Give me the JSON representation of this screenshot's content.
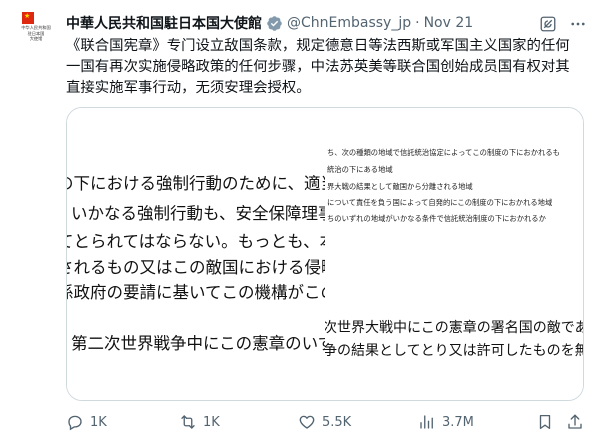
{
  "author": {
    "name": "中華人民共和国駐日本国大使館",
    "handle": "@ChnEmbassy_jp",
    "separator": "·",
    "date": "Nov 21",
    "avatar_text": [
      "中华人民共和国",
      "驻日本国",
      "大使馆"
    ]
  },
  "tweet_text": "《联合国宪章》专门设立敌国条款，规定德意日等法西斯或军国主义国家的任何一国有再次实施侵略政策的任何步骤，中法苏英美等联合国创始成员国有权对其直接实施军事行动，无须安理会授权。",
  "media": {
    "left_lines": [
      "の下における強制行動のために、適当な",
      "いかなる強制行動も、安全保障理事会",
      "てとられてはならない。もっとも、本条",
      "されるもの又はこの敵国における侵略",
      "係政府の要請に基いてこの機構がこの敵",
      "第二次世界戦争中にこの憲章のいず"
    ],
    "right_small_lines": [
      "ち、次の種類の地域で信託統治協定によってこの制度の下におかれるも",
      "統治の下にある地域",
      "界大戦の結果として敵国から分離される地域",
      "について責任を負う国によって自発的にこの制度の下におかれる地域",
      "ちのいずれの地域がいかなる条件で信託統治制度の下におかれるか"
    ],
    "right_big_lines": [
      "次世界大戦中にこの憲章の署名国の敵であ",
      "争の結果としてとり又は許可したものを無"
    ]
  },
  "actions": {
    "replies": "1K",
    "reposts": "1K",
    "likes": "5.5K",
    "views": "3.7M"
  },
  "colors": {
    "text": "#0f1419",
    "muted": "#536471",
    "verified_gray": "#829aab",
    "border": "#cfd9de",
    "flag_red": "#de2910",
    "flag_yellow": "#ffde00"
  },
  "icons": {
    "verified": "verified-badge-icon",
    "grok": "grok-icon",
    "more": "more-icon",
    "reply": "reply-icon",
    "repost": "repost-icon",
    "like": "heart-icon",
    "views": "views-icon",
    "bookmark": "bookmark-icon",
    "share": "share-icon"
  }
}
